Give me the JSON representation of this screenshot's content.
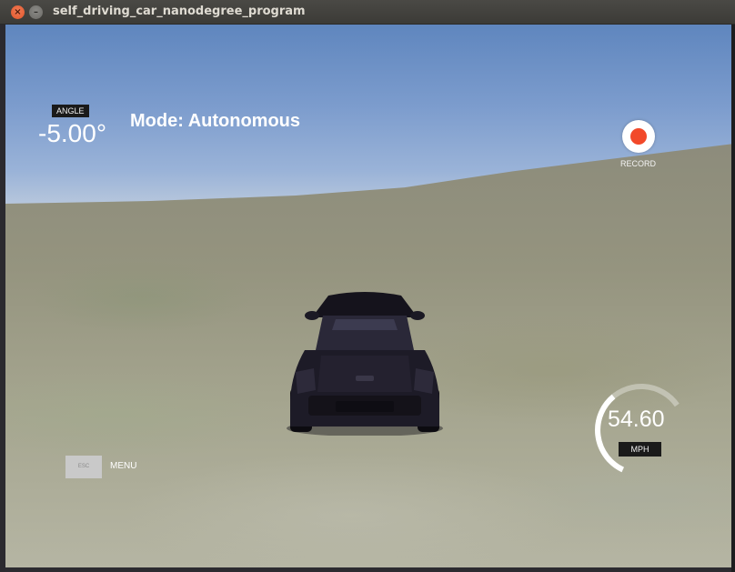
{
  "window": {
    "title": "self_driving_car_nanodegree_program",
    "close_glyph": "×",
    "minimize_glyph": "–"
  },
  "hud": {
    "angle_label": "ANGLE",
    "angle_value": "-5.00°",
    "mode_text": "Mode: Autonomous",
    "record_label": "RECORD",
    "esc_label": "ESC",
    "menu_label": "MENU",
    "speed_value": "54.60",
    "speed_unit": "MPH",
    "speed_fraction": 0.55
  },
  "colors": {
    "record_dot": "#f2492a",
    "close_button": "#e2562a",
    "sky": "#7c9ccd",
    "ground": "#95947f"
  },
  "icons": {
    "close": "close-icon",
    "minimize": "minimize-icon",
    "record": "record-icon"
  }
}
